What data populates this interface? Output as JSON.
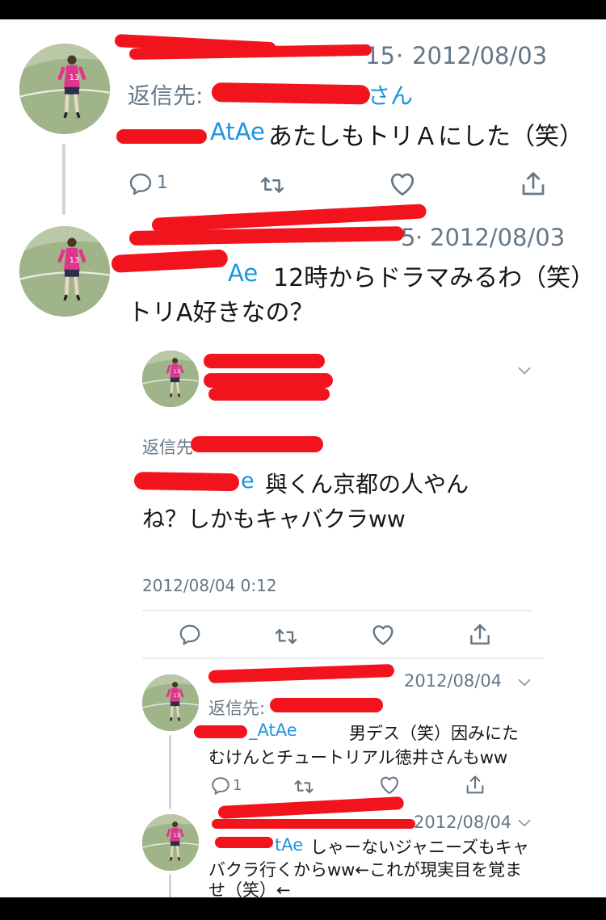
{
  "tweet1": {
    "handle_partial": "15",
    "date": "2012/08/03",
    "reply_prefix": "返信先:",
    "reply_suffix": "さん",
    "mention_partial": "AtAe",
    "text": "あたしもトリＡにした（笑）",
    "reply_count": "1"
  },
  "tweet2": {
    "handle_partial": "5",
    "date": "2012/08/03",
    "mention_partial": "Ae",
    "text_line1": "12時からドラマみるわ（笑）",
    "text_line2": "トリA好きなの？"
  },
  "focused": {
    "reply_prefix": "返信先",
    "mention_partial": "e",
    "text_line1": "與くん京都の人やん",
    "text_line2": "ね？しかもキャバクラww",
    "timestamp": "2012/08/04 0:12"
  },
  "reply1": {
    "date": "2012/08/04",
    "reply_prefix": "返信先:",
    "mention_partial": "_AtAe",
    "text_line1": "男デス（笑）因みにた",
    "text_line2": "むけんとチュートリアル徳井さんもww",
    "reply_count": "1"
  },
  "reply2": {
    "date": "2012/08/04",
    "mention_partial": "tAe",
    "text_line1": "しゃーないジャニーズもキャ",
    "text_line2": "バクラ行くからww←これが現実目を覚ま",
    "text_line3": "せ（笑）←"
  },
  "icons": {
    "reply": "speech-bubble-icon",
    "retweet": "retweet-icon",
    "like": "heart-icon",
    "share": "share-icon",
    "caret": "chevron-down-icon"
  },
  "colors": {
    "link": "#1b95e0",
    "muted": "#657786",
    "redaction": "#f2141d",
    "avatar_jersey": "#e0358f"
  }
}
